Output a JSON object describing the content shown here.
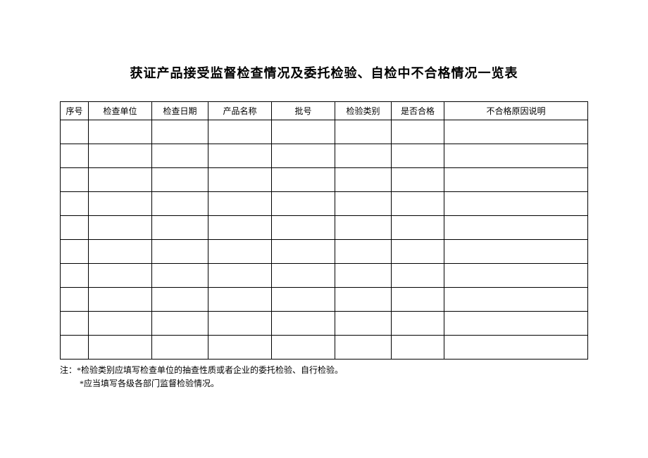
{
  "title": "获证产品接受监督检查情况及委托检验、自检中不合格情况一览表",
  "headers": {
    "seq": "序号",
    "unit": "检查单位",
    "date": "检查日期",
    "product": "产品名称",
    "batch": "批号",
    "category": "检验类别",
    "pass": "是否合格",
    "reason": "不合格原因说明"
  },
  "rows": [
    {
      "seq": "",
      "unit": "",
      "date": "",
      "product": "",
      "batch": "",
      "category": "",
      "pass": "",
      "reason": ""
    },
    {
      "seq": "",
      "unit": "",
      "date": "",
      "product": "",
      "batch": "",
      "category": "",
      "pass": "",
      "reason": ""
    },
    {
      "seq": "",
      "unit": "",
      "date": "",
      "product": "",
      "batch": "",
      "category": "",
      "pass": "",
      "reason": ""
    },
    {
      "seq": "",
      "unit": "",
      "date": "",
      "product": "",
      "batch": "",
      "category": "",
      "pass": "",
      "reason": ""
    },
    {
      "seq": "",
      "unit": "",
      "date": "",
      "product": "",
      "batch": "",
      "category": "",
      "pass": "",
      "reason": ""
    },
    {
      "seq": "",
      "unit": "",
      "date": "",
      "product": "",
      "batch": "",
      "category": "",
      "pass": "",
      "reason": ""
    },
    {
      "seq": "",
      "unit": "",
      "date": "",
      "product": "",
      "batch": "",
      "category": "",
      "pass": "",
      "reason": ""
    },
    {
      "seq": "",
      "unit": "",
      "date": "",
      "product": "",
      "batch": "",
      "category": "",
      "pass": "",
      "reason": ""
    },
    {
      "seq": "",
      "unit": "",
      "date": "",
      "product": "",
      "batch": "",
      "category": "",
      "pass": "",
      "reason": ""
    },
    {
      "seq": "",
      "unit": "",
      "date": "",
      "product": "",
      "batch": "",
      "category": "",
      "pass": "",
      "reason": ""
    }
  ],
  "notes": {
    "prefix": "注：",
    "line1": "*检验类别应填写检查单位的抽查性质或者企业的委托检验、自行检验。",
    "line2": "*应当填写各级各部门监督检验情况。"
  }
}
